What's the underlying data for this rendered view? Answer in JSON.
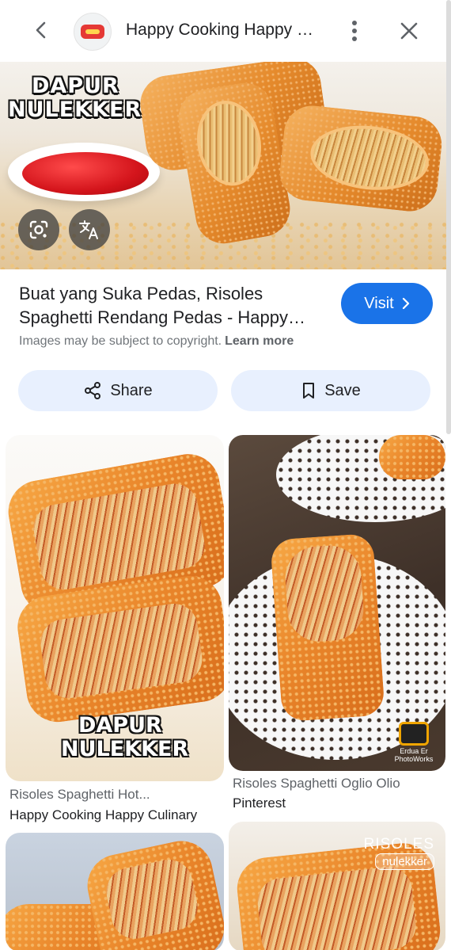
{
  "header": {
    "title": "Happy Cooking Happy Culinary"
  },
  "hero": {
    "brand_line1": "DAPUR",
    "brand_line2": "NULEKKER",
    "lens_icon": "google-lens-icon",
    "translate_icon": "translate-icon"
  },
  "result": {
    "headline": "Buat yang Suka Pedas, Risoles Spaghetti Rendang Pedas - Happy Cooking Happy Culinary",
    "visit_label": "Visit",
    "copyright_text": "Images may be subject to copyright.",
    "learn_more": "Learn more",
    "share_label": "Share",
    "save_label": "Save"
  },
  "grid": [
    {
      "title": "Risoles Spaghetti Hot...",
      "source": "Happy Cooking Happy Culinary",
      "watermark_line1": "DAPUR",
      "watermark_line2": "NULEKKER"
    },
    {
      "title": "Risoles Spaghetti Oglio Olio",
      "source": "Pinterest",
      "watermark_line1": "Erdua Er",
      "watermark_line2": "PhotoWorks"
    },
    {
      "title": "",
      "source": ""
    },
    {
      "title": "",
      "source": "",
      "watermark_line1": "RISOLES",
      "watermark_line2": "nulekker"
    }
  ],
  "colors": {
    "accent": "#1a73e8",
    "pill_bg": "#e8f0fe"
  }
}
